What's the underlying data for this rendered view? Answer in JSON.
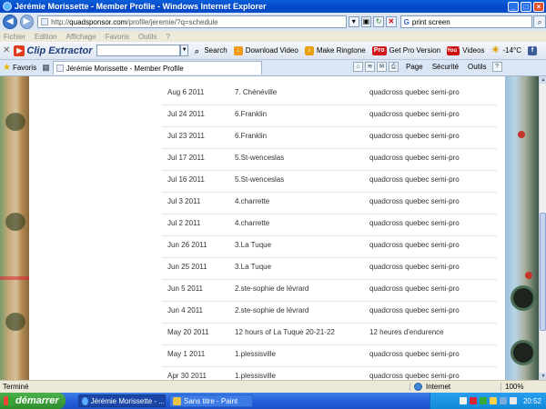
{
  "window": {
    "title": "Jérémie Morissette - Member Profile - Windows Internet Explorer",
    "minimize": "_",
    "maximize": "□",
    "close": "×"
  },
  "address": {
    "url_prefix": "http://",
    "url_domain": "quadsponsor.com",
    "url_path": "/profile/jeremie/?q=schedule",
    "search_value": "print screen",
    "search_engine": "G"
  },
  "menu": [
    "Fichier",
    "Edition",
    "Affichage",
    "Favoris",
    "Outils",
    "?"
  ],
  "clip_extractor": {
    "brand": "Clip Extractor",
    "search": "Search",
    "download_video": "Download Video",
    "make_ringtone": "Make Ringtone",
    "pro_badge": "Pro",
    "get_pro": "Get Pro Version",
    "videos": "Videos",
    "youtube_badge": "You Tube",
    "weather": "-14°C"
  },
  "favorites": {
    "label": "Favoris",
    "tab_title": "Jérémie Morissette - Member Profile",
    "page": "Page",
    "security": "Sécurité",
    "tools": "Outils"
  },
  "schedule": [
    {
      "date": "Aug 6 2011",
      "event": "7. Chénéville",
      "series": "quadcross quebec semi-pro"
    },
    {
      "date": "Jul 24 2011",
      "event": "6.Franklin",
      "series": "quadcross quebec semi-pro"
    },
    {
      "date": "Jul 23 2011",
      "event": "6.Franklin",
      "series": "quadcross quebec semi-pro"
    },
    {
      "date": "Jul 17 2011",
      "event": "5.St-wenceslas",
      "series": "quadcross quebec semi-pro"
    },
    {
      "date": "Jul 16 2011",
      "event": "5.St-wenceslas",
      "series": "quadcross quebec semi-pro"
    },
    {
      "date": "Jul 3 2011",
      "event": "4.charrette",
      "series": "quadcross quebec semi-pro"
    },
    {
      "date": "Jul 2 2011",
      "event": "4.charrette",
      "series": "quadcross quebec semi-pro"
    },
    {
      "date": "Jun 26 2011",
      "event": "3.La Tuque",
      "series": "quadcross quebec semi-pro"
    },
    {
      "date": "Jun 25 2011",
      "event": "3.La Tuque",
      "series": "quadcross quebec semi-pro"
    },
    {
      "date": "Jun 5 2011",
      "event": "2.ste-sophie de lévrard",
      "series": "quadcross quebec semi-pro"
    },
    {
      "date": "Jun 4 2011",
      "event": "2.ste-sophie de lévrard",
      "series": "quadcross quebec semi-pro"
    },
    {
      "date": "May 20 2011",
      "event": "12 hours of La Tuque 20-21-22",
      "series": "12 heures d'endurence"
    },
    {
      "date": "May 1 2011",
      "event": "1.plessisville",
      "series": "quadcross quebec semi-pro"
    },
    {
      "date": "Apr 30 2011",
      "event": "1.plessisville",
      "series": "quadcross quebec semi-pro"
    }
  ],
  "status": {
    "text": "Terminé",
    "zone": "Internet",
    "zoom": "100%"
  },
  "taskbar": {
    "start": "démarrer",
    "task1": "Jérémie Morissette - ...",
    "task2": "Sans titre - Paint",
    "clock": "20:52"
  }
}
